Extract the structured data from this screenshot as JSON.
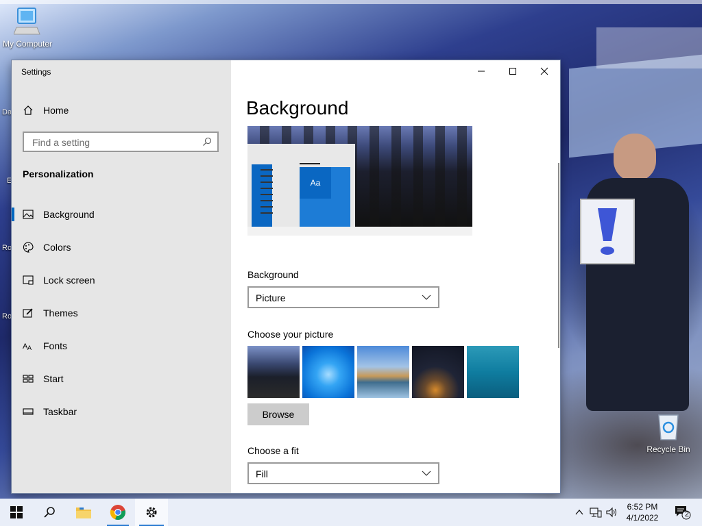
{
  "desktop": {
    "my_computer_label": "My Computer",
    "recycle_bin_label": "Recycle Bin",
    "edge_labels": [
      "Da",
      "E",
      "Ro",
      "Ro"
    ]
  },
  "window": {
    "title": "Settings",
    "controls": {
      "minimize": "—",
      "maximize": "☐",
      "close": "✕"
    }
  },
  "nav": {
    "home_label": "Home",
    "search_placeholder": "Find a setting",
    "section_title": "Personalization",
    "items": [
      {
        "label": "Background",
        "icon": "picture-icon",
        "active": true
      },
      {
        "label": "Colors",
        "icon": "palette-icon",
        "active": false
      },
      {
        "label": "Lock screen",
        "icon": "lock-screen-icon",
        "active": false
      },
      {
        "label": "Themes",
        "icon": "themes-icon",
        "active": false
      },
      {
        "label": "Fonts",
        "icon": "fonts-icon",
        "active": false
      },
      {
        "label": "Start",
        "icon": "start-icon",
        "active": false
      },
      {
        "label": "Taskbar",
        "icon": "taskbar-icon",
        "active": false
      }
    ]
  },
  "content": {
    "page_title": "Background",
    "preview_tile_text": "Aa",
    "background_label": "Background",
    "background_value": "Picture",
    "choose_picture_label": "Choose your picture",
    "browse_label": "Browse",
    "choose_fit_label": "Choose a fit",
    "fit_value": "Fill"
  },
  "taskbar": {
    "time": "6:52 PM",
    "date": "4/1/2022",
    "notification_count": "2",
    "accent": "#2a7ad1"
  }
}
